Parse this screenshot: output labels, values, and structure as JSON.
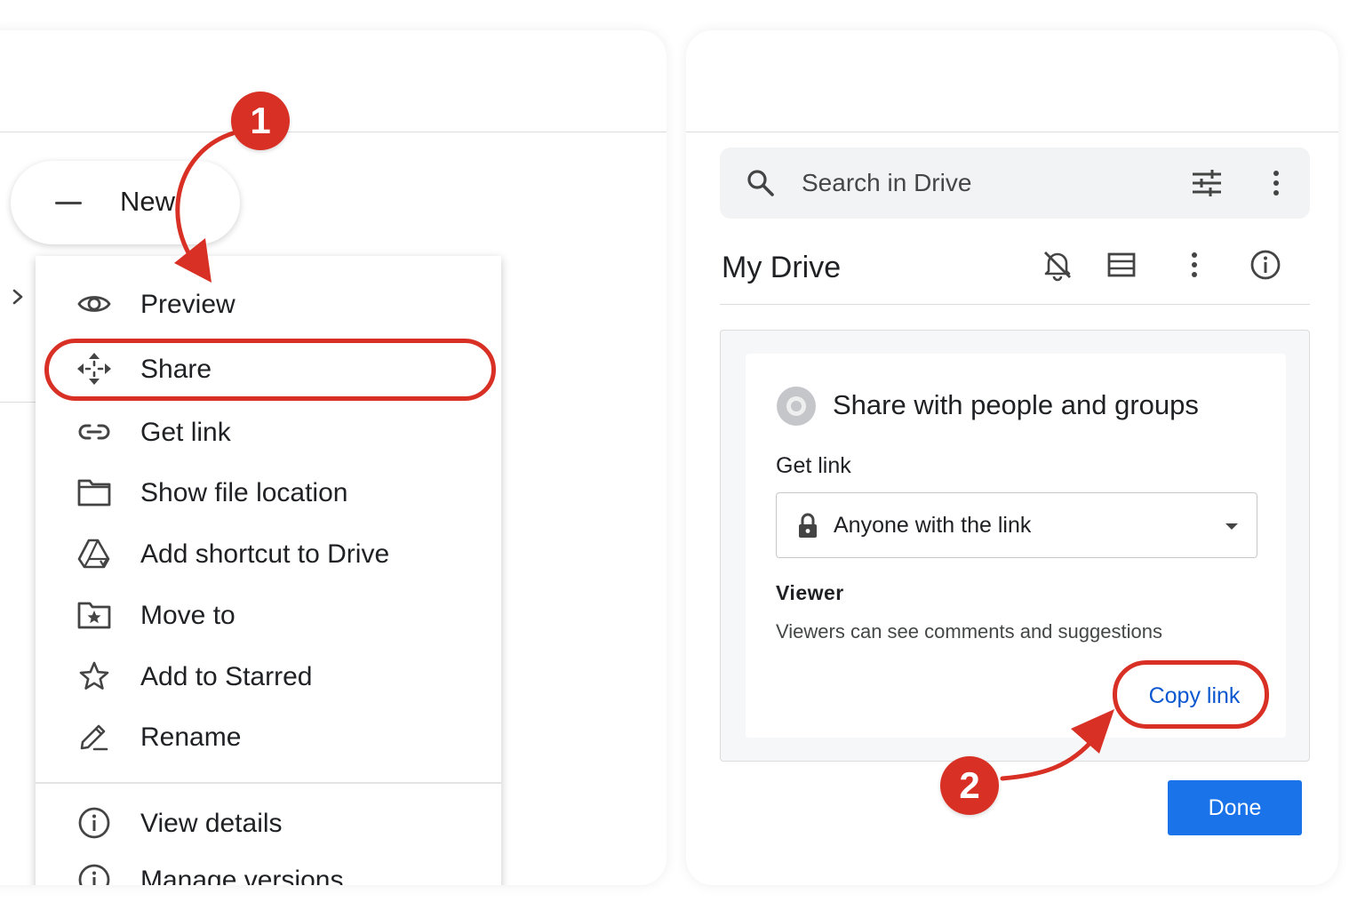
{
  "left": {
    "new_button_label": "New",
    "menu_items": [
      {
        "label": "Preview",
        "icon": "eye-icon"
      },
      {
        "label": "Share",
        "icon": "move-arrows-icon"
      },
      {
        "label": "Get link",
        "icon": "link-icon"
      },
      {
        "label": "Show file location",
        "icon": "folder-icon"
      },
      {
        "label": "Add shortcut to Drive",
        "icon": "drive-shortcut-icon"
      },
      {
        "label": "Move to",
        "icon": "folder-star-icon"
      },
      {
        "label": "Add to Starred",
        "icon": "star-icon"
      },
      {
        "label": "Rename",
        "icon": "pencil-icon"
      },
      {
        "label": "View details",
        "icon": "info-icon"
      },
      {
        "label": "Manage versions",
        "icon": "info-icon"
      }
    ]
  },
  "right": {
    "search_placeholder": "Search in Drive",
    "drive_title": "My Drive",
    "share_dialog": {
      "title": "Share with people and groups",
      "get_link_label": "Get link",
      "access_value": "Anyone with the link",
      "role_label": "Viewer",
      "role_description": "Viewers can see comments and suggestions",
      "copy_link_label": "Copy link"
    },
    "done_label": "Done"
  },
  "annotations": {
    "step1": "1",
    "step2": "2",
    "accent_color": "#d93025"
  }
}
